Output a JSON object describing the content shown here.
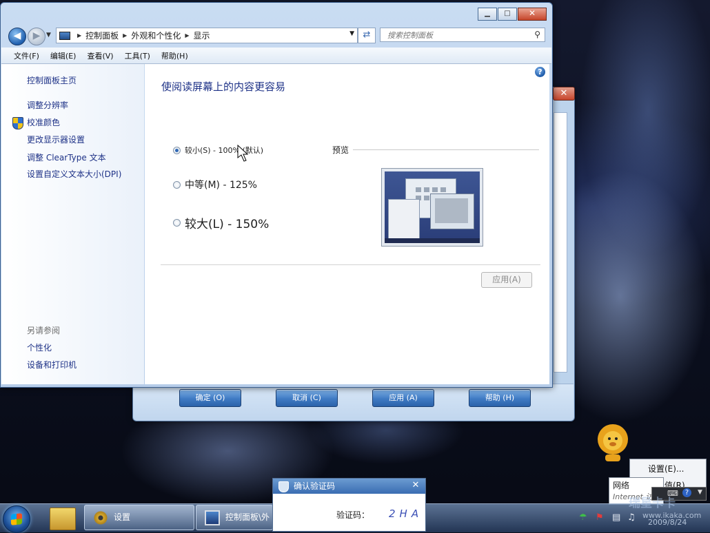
{
  "window": {
    "minimize_glyph": "▁",
    "maximize_glyph": "□",
    "close_glyph": "✕"
  },
  "address": {
    "crumbs": [
      "控制面板",
      "外观和个性化",
      "显示"
    ]
  },
  "search": {
    "placeholder": "搜索控制面板"
  },
  "menu": [
    "文件(F)",
    "编辑(E)",
    "查看(V)",
    "工具(T)",
    "帮助(H)"
  ],
  "sidebar": {
    "home": "控制面板主页",
    "links": [
      "调整分辨率",
      "校准颜色",
      "更改显示器设置",
      "调整 ClearType 文本",
      "设置自定义文本大小(DPI)"
    ],
    "see_also_title": "另请参阅",
    "see_also": [
      "个性化",
      "设备和打印机"
    ]
  },
  "content": {
    "title": "使阅读屏幕上的内容更容易",
    "options": [
      {
        "label": "较小(S) - 100% (默认)",
        "selected": true
      },
      {
        "label": "中等(M) - 125%",
        "selected": false
      },
      {
        "label": "较大(L) - 150%",
        "selected": false
      }
    ],
    "preview_label": "预览",
    "apply_label": "应用(A)",
    "help_glyph": "?"
  },
  "bg_dialog": {
    "buttons": [
      "确定 (O)",
      "取消 (C)",
      "应用 (A)",
      "帮助 (H)"
    ],
    "close_glyph": "✕"
  },
  "taskbar": {
    "tasks": [
      "设置",
      "控制面板\\外"
    ]
  },
  "captcha": {
    "title": "确认验证码",
    "label": "验证码：",
    "code": "2HA"
  },
  "context_menu": {
    "item1": "设置(E)...",
    "item2": "默认值(R)"
  },
  "net_tooltip": {
    "title": "网络",
    "subtitle": "Internet 访"
  },
  "tray": {
    "watermark": "瑞星卡卡",
    "site": "www.ikaka.com",
    "date": "2009/8/24"
  }
}
